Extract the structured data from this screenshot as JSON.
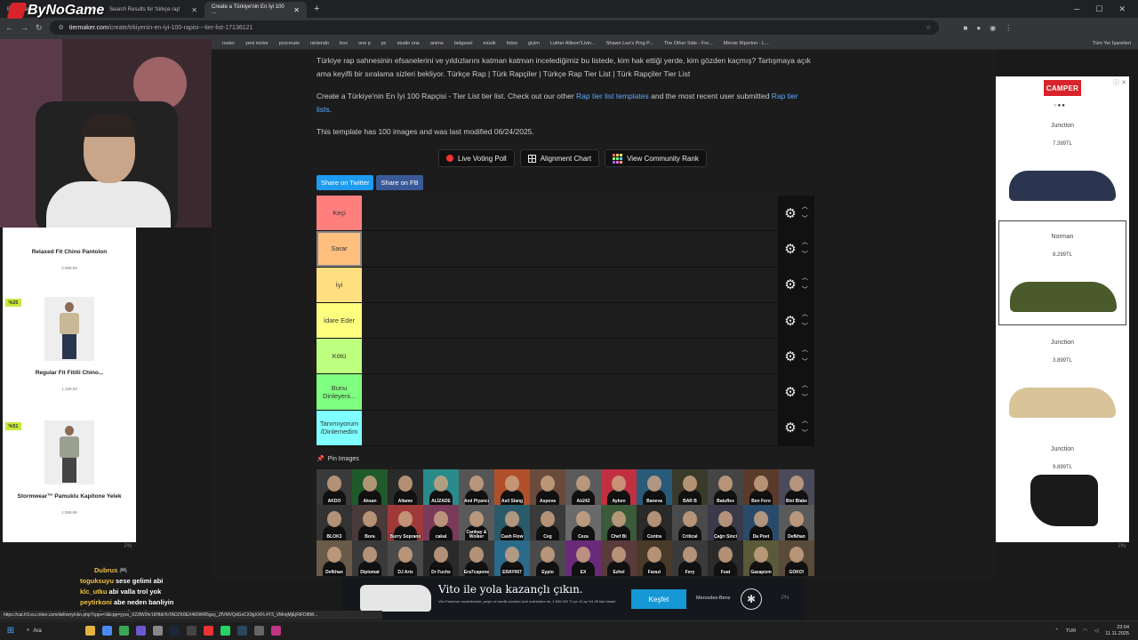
{
  "browser": {
    "tabs": [
      {
        "label": "ByNoGame"
      },
      {
        "label": "Search Results for 'türkçe rap'"
      },
      {
        "label": "Create a Türkiye'nin En İyi 100 ..."
      }
    ],
    "url_domain": "tiermaker.com",
    "url_path": "/create/trkiyenin-en-iyi-100-rapisi---tier-list-17136121",
    "bookmarks": [
      "roster",
      "yeni motor",
      "procreate",
      "nintendo",
      "box",
      "one p",
      "pc",
      "studio one",
      "anime",
      "belgesel",
      "müzik",
      "fotoo",
      "giyim",
      "Luther Allison\"Livin...",
      "Shawn Lee's Ping P...",
      "The Other Side - Fre...",
      "Minnie Riperton - L..."
    ],
    "bookmarks_right": "Tüm Yer İşaretleri"
  },
  "page": {
    "desc1": "Türkiye rap sahnesinin efsanelerini ve yıldızlarını katman katman incelediğimiz bu listede, kim hak ettiği yerde, kim gözden kaçmış? Tartışmaya açık ama keyifli bir sıralama sizleri bekliyor. Türkçe Rap | Türk Rapçiler | Türkçe Rap Tier List | Türk Rapçiler Tier List",
    "desc2_pre": "Create a Türkiye'nin En İyi 100 Rapçisi - Tier List tier list. Check out our other ",
    "desc2_link1": "Rap tier list templates",
    "desc2_mid": " and the most recent user submitted ",
    "desc2_link2": "Rap tier lists",
    "desc2_post": ".",
    "desc3": "This template has 100 images and was last modified 06/24/2025.",
    "buttons": {
      "live_voting": "Live Voting Poll",
      "alignment": "Alignment Chart",
      "community": "View Community Rank"
    },
    "share": {
      "twitter": "Share on Twitter",
      "fb": "Share on FB"
    },
    "tiers": [
      {
        "label": "Keçi",
        "color": "#ff7f7f"
      },
      {
        "label": "Sarar",
        "color": "#ffbf7f"
      },
      {
        "label": "İyi",
        "color": "#ffdf7f"
      },
      {
        "label": "İdare Eder",
        "color": "#ffff7f"
      },
      {
        "label": "Kötü",
        "color": "#bfff7f"
      },
      {
        "label": "Bunu Dinleyeni...",
        "color": "#7fff7f"
      },
      {
        "label": "Tanımıyorum /Dinlemedim",
        "color": "#7fffff"
      }
    ],
    "pin_label": "Pin Images",
    "images": [
      {
        "name": "AKDO",
        "bg": "#3a3a3a"
      },
      {
        "name": "Aksan",
        "bg": "#1f5a2a"
      },
      {
        "name": "Allame",
        "bg": "#2a2a2a"
      },
      {
        "name": "ALİZADE",
        "bg": "#2a8a8a"
      },
      {
        "name": "Anıl Piyancı",
        "bg": "#555"
      },
      {
        "name": "Asil Slang",
        "bg": "#b0502a"
      },
      {
        "name": "Aspova",
        "bg": "#6a4a3a"
      },
      {
        "name": "Atı242",
        "bg": "#5a5a5a"
      },
      {
        "name": "Ayben",
        "bg": "#c03040"
      },
      {
        "name": "Baneva",
        "bg": "#2a5a7a"
      },
      {
        "name": "BAR B",
        "bg": "#3a3a2a"
      },
      {
        "name": "Batuflex",
        "bg": "#444"
      },
      {
        "name": "Ben Fero",
        "bg": "#5a3a2a"
      },
      {
        "name": "Bixi Blake",
        "bg": "#4a4a5a"
      },
      {
        "name": "BLOK3",
        "bg": "#333"
      },
      {
        "name": "Bora",
        "bg": "#4a3a3a"
      },
      {
        "name": "Burry Soprano",
        "bg": "#a03a3a"
      },
      {
        "name": "cakal",
        "bg": "#7a3a5a"
      },
      {
        "name": "Canbay & Wolker",
        "bg": "#5a5a5a"
      },
      {
        "name": "Cash Flow",
        "bg": "#2a5a6a"
      },
      {
        "name": "Ceg",
        "bg": "#3a3a3a"
      },
      {
        "name": "Ceza",
        "bg": "#6a6a6a"
      },
      {
        "name": "Chef Bi",
        "bg": "#3a5a3a"
      },
      {
        "name": "Contra",
        "bg": "#2a2a2a"
      },
      {
        "name": "Critical",
        "bg": "#4a4a4a"
      },
      {
        "name": "Çağrı Sinci",
        "bg": "#3a3a4a"
      },
      {
        "name": "Da Poet",
        "bg": "#2a4a6a"
      },
      {
        "name": "Defkhan",
        "bg": "#5a5a5a"
      },
      {
        "name": "Defkhan",
        "bg": "#6a5a4a"
      },
      {
        "name": "Diplomat",
        "bg": "#3a3a3a"
      },
      {
        "name": "DJ Artz",
        "bg": "#4a4a4a"
      },
      {
        "name": "Dr Fuchs",
        "bg": "#2a2a2a"
      },
      {
        "name": "Era7capone",
        "bg": "#3a3a3a"
      },
      {
        "name": "ERAY067",
        "bg": "#2a6a8a"
      },
      {
        "name": "Eypio",
        "bg": "#4a4a4a"
      },
      {
        "name": "EX",
        "bg": "#6a2a7a"
      },
      {
        "name": "Ezhel",
        "bg": "#5a3a3a"
      },
      {
        "name": "Farazi",
        "bg": "#4a3a2a"
      },
      {
        "name": "Fery",
        "bg": "#3a3a3a"
      },
      {
        "name": "Fuat",
        "bg": "#2a2a2a"
      },
      {
        "name": "Gazapizm",
        "bg": "#5a5a3a"
      },
      {
        "name": "GOKO!",
        "bg": "#5a4a3a"
      }
    ]
  },
  "left_ad": {
    "products": [
      {
        "name": "Relaxed Fit Chino Pantolon",
        "price": "2.999,99"
      },
      {
        "name": "Regular Fit Fitilli Chino...",
        "price": "1.199,99",
        "badge": "%25"
      },
      {
        "name": "Stormwear™ Pamuklu Kapitone Yelek",
        "price": "1.599,99",
        "badge": "%51"
      }
    ],
    "pn": "PN"
  },
  "right_ad": {
    "brand": "CAMPER",
    "close": "ⓘ ✕",
    "items": [
      {
        "name": "Junction",
        "price": "7.399TL",
        "color": "#2c3550"
      },
      {
        "name": "Norman",
        "price": "8.299TL",
        "color": "#4a5a2a"
      },
      {
        "name": "Junction",
        "price": "3.899TL",
        "color": "#d9c49a"
      },
      {
        "name": "Junction",
        "price": "9.899TL",
        "color": "#1a1a1a"
      }
    ],
    "pn": "PN"
  },
  "overlay": {
    "logo": "ByNoGame",
    "chat": [
      {
        "user": "Dubrus",
        "msg": "🎮"
      },
      {
        "user": "toguksuyu",
        "msg": "sese gelimi abi"
      },
      {
        "user": "klc_utku",
        "msg": "abi valla trol yok"
      },
      {
        "user": "peytirkoni",
        "msg": "abe neden banliyin"
      },
      {
        "user": "klc_utku",
        "msg": "ps 4 alcam ben"
      }
    ]
  },
  "status_url": "https://cat.fr3.eu.criteo.com/delivery/ckn.php?cppv=3&cpp=yyxs_X22lW2hr1tIHbbToTADZK6EX465WR5guy_ZfVMVQdGxCX9gXXFL4Y3_VMmjMjEjRiFDI8W...",
  "bottom_ad": {
    "title": "Vito ile yola kazançlı çıkın.",
    "subtitle": "Vito Panelvan modellerinde, peşin ve kredili alımlara özel indirimlere ek, 1.500.000 TL'ye 12 ay %1,99 faiz fırsatı!",
    "cta": "Keşfet",
    "brand": "Mercedes-Benz",
    "pn": "PN"
  },
  "taskbar": {
    "search": "Ara",
    "time": "23:04",
    "date": "11.11.2025",
    "lang": "TUR"
  }
}
